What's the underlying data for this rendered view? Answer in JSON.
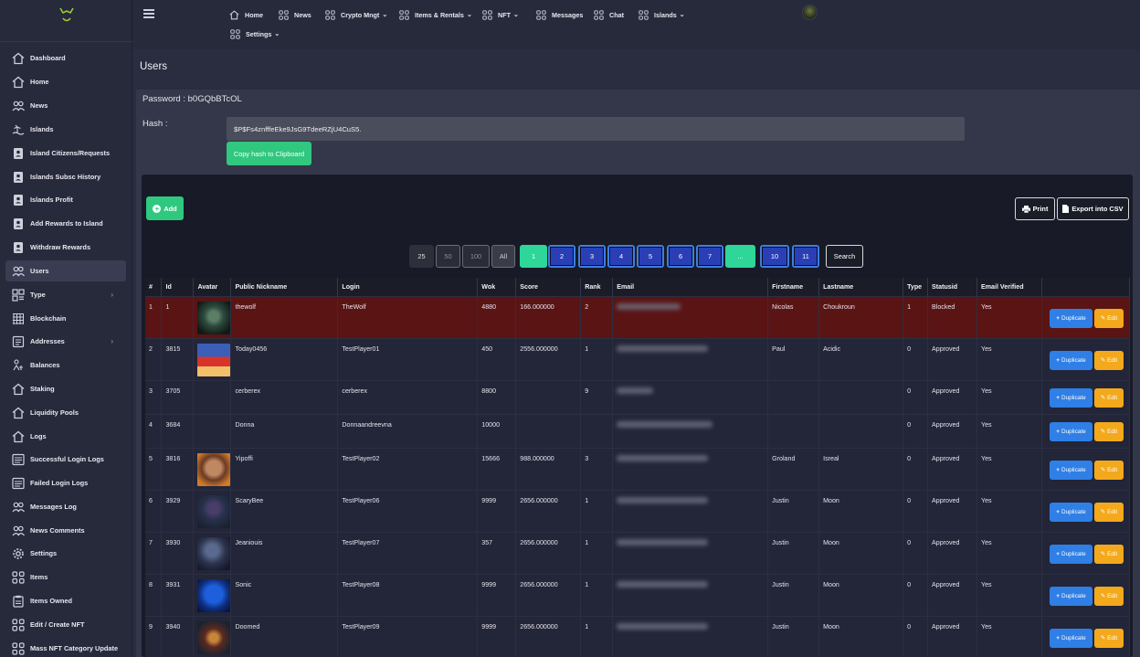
{
  "sidebar": {
    "items": [
      {
        "label": "Dashboard",
        "icon": "home-icon"
      },
      {
        "label": "Home",
        "icon": "home-icon"
      },
      {
        "label": "News",
        "icon": "users-icon"
      },
      {
        "label": "Islands",
        "icon": "island-icon"
      },
      {
        "label": "Island Citizens/Requests",
        "icon": "id-card-icon"
      },
      {
        "label": "Islands Subsc History",
        "icon": "id-card-icon"
      },
      {
        "label": "Islands Profit",
        "icon": "id-card-icon"
      },
      {
        "label": "Add Rewards to Island",
        "icon": "id-card-icon"
      },
      {
        "label": "Withdraw Rewards",
        "icon": "id-card-icon"
      },
      {
        "label": "Users",
        "icon": "users-icon",
        "active": true
      },
      {
        "label": "Type",
        "icon": "type-icon",
        "chevron": "›"
      },
      {
        "label": "Blockchain",
        "icon": "grid-icon"
      },
      {
        "label": "Addresses",
        "icon": "address-icon",
        "chevron": "›"
      },
      {
        "label": "Balances",
        "icon": "balance-icon"
      },
      {
        "label": "Staking",
        "icon": "home-icon"
      },
      {
        "label": "Liquidity Pools",
        "icon": "home-icon"
      },
      {
        "label": "Logs",
        "icon": "home-icon"
      },
      {
        "label": "Successful Login Logs",
        "icon": "list-icon"
      },
      {
        "label": "Failed Login Logs",
        "icon": "list-icon"
      },
      {
        "label": "Messages Log",
        "icon": "users-icon"
      },
      {
        "label": "News Comments",
        "icon": "users-icon"
      },
      {
        "label": "Settings",
        "icon": "gear-icon"
      },
      {
        "label": "Items",
        "icon": "apps-icon"
      },
      {
        "label": "Items Owned",
        "icon": "clipboard-icon"
      },
      {
        "label": "Edit / Create NFT",
        "icon": "apps-icon"
      },
      {
        "label": "Mass NFT Category Update",
        "icon": "apps-icon"
      }
    ]
  },
  "topnav": {
    "items": [
      {
        "label": "Home",
        "icon": "home-icon",
        "caret": ""
      },
      {
        "label": "News",
        "icon": "apps-icon",
        "caret": ""
      },
      {
        "label": "Crypto Mngt",
        "icon": "apps-icon",
        "caret": "⌄"
      },
      {
        "label": "Items & Rentals",
        "icon": "apps-icon",
        "caret": "⌄"
      },
      {
        "label": "NFT",
        "icon": "apps-icon",
        "caret": "⌄"
      },
      {
        "label": "Messages",
        "icon": "apps-icon",
        "caret": ""
      },
      {
        "label": "Chat",
        "icon": "apps-icon",
        "caret": ""
      },
      {
        "label": "Islands",
        "icon": "apps-icon",
        "caret": "⌄"
      },
      {
        "label": "Settings",
        "icon": "apps-icon",
        "caret": "⌄"
      }
    ]
  },
  "page": {
    "title": "Users",
    "password_line": "Password : b0GQbBTcOL",
    "hash_label": "Hash :",
    "hash_value": "$P$Fs4znfffeEke9JsG9TdeeRZjU4CuS5.",
    "copy_button": "Copy hash to Clipboard"
  },
  "toolbar": {
    "add_label": "Add",
    "print_label": "Print",
    "csv_label": "Export into CSV"
  },
  "pagination": {
    "sizes": [
      "25",
      "50",
      "100",
      "All"
    ],
    "pages": [
      "1",
      "2",
      "3",
      "4",
      "5",
      "6",
      "7",
      "...",
      "10",
      "11"
    ],
    "search_label": "Search"
  },
  "table": {
    "headers": [
      "#",
      "Id",
      "Avatar",
      "Public Nickname",
      "Login",
      "Wok",
      "Score",
      "Rank",
      "Email",
      "Firstname",
      "Lastname",
      "Type",
      "Statusid",
      "Email Verified",
      ""
    ],
    "duplicate_label": "Duplicate",
    "edit_label": "Edit",
    "rows": [
      {
        "n": "1",
        "id": "1",
        "nick": "thewolf",
        "login": "TheWolf",
        "wok": "4880",
        "score": "166.000000",
        "rank": "2",
        "first": "Nicolas",
        "last": "Choukroun",
        "type": "1",
        "status": "Blocked",
        "verified": "Yes",
        "avatar": "wolf-avatar",
        "highlight": true
      },
      {
        "n": "2",
        "id": "3815",
        "nick": "Today0456",
        "login": "TestPlayer01",
        "wok": "450",
        "score": "2556.000000",
        "rank": "1",
        "first": "Paul",
        "last": "Acidic",
        "type": "0",
        "status": "Approved",
        "verified": "Yes",
        "avatar": "hero-avatar"
      },
      {
        "n": "3",
        "id": "3705",
        "nick": "cerberex",
        "login": "cerberex",
        "wok": "8800",
        "score": "",
        "rank": "9",
        "first": "",
        "last": "",
        "type": "0",
        "status": "Approved",
        "verified": "Yes",
        "avatar": ""
      },
      {
        "n": "4",
        "id": "3684",
        "nick": "Donna",
        "login": "Donnaandreevna",
        "wok": "10000",
        "score": "",
        "rank": "",
        "first": "",
        "last": "",
        "type": "0",
        "status": "Approved",
        "verified": "Yes",
        "avatar": ""
      },
      {
        "n": "5",
        "id": "3816",
        "nick": "Yipoffi",
        "login": "TestPlayer02",
        "wok": "15666",
        "score": "988.000000",
        "rank": "3",
        "first": "Groland",
        "last": "Isreal",
        "type": "0",
        "status": "Approved",
        "verified": "Yes",
        "avatar": "bearded-avatar"
      },
      {
        "n": "6",
        "id": "3929",
        "nick": "ScaryBee",
        "login": "TestPlayer06",
        "wok": "9999",
        "score": "2656.000000",
        "rank": "1",
        "first": "Justin",
        "last": "Moon",
        "type": "0",
        "status": "Approved",
        "verified": "Yes",
        "avatar": "ninja-avatar"
      },
      {
        "n": "7",
        "id": "3930",
        "nick": "Jeaniouis",
        "login": "TestPlayer07",
        "wok": "357",
        "score": "2656.000000",
        "rank": "1",
        "first": "Justin",
        "last": "Moon",
        "type": "0",
        "status": "Approved",
        "verified": "Yes",
        "avatar": "warrior-avatar"
      },
      {
        "n": "8",
        "id": "3931",
        "nick": "Sonic",
        "login": "TestPlayer08",
        "wok": "9999",
        "score": "2656.000000",
        "rank": "1",
        "first": "Justin",
        "last": "Moon",
        "type": "0",
        "status": "Approved",
        "verified": "Yes",
        "avatar": "sonic-avatar"
      },
      {
        "n": "9",
        "id": "3940",
        "nick": "Doomed",
        "login": "TestPlayer09",
        "wok": "9999",
        "score": "2656.000000",
        "rank": "1",
        "first": "Justin",
        "last": "Moon",
        "type": "0",
        "status": "Approved",
        "verified": "Yes",
        "avatar": "skull-avatar"
      }
    ]
  }
}
